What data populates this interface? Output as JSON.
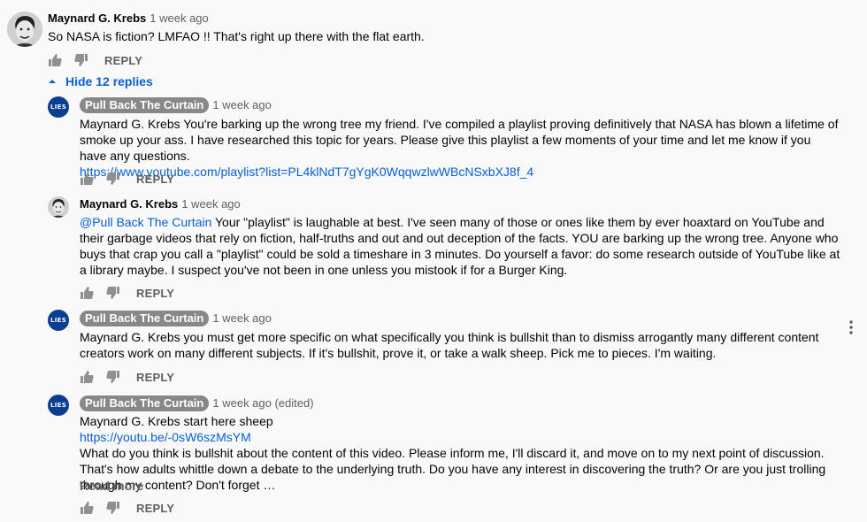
{
  "top_comment": {
    "author": "Maynard G. Krebs",
    "time": "1 week ago",
    "text": "So NASA is fiction?  LMFAO !!  That's right up there with the flat earth.",
    "reply_label": "REPLY"
  },
  "hide_replies_label": "Hide 12 replies",
  "avatar_text": "LIES",
  "replies": [
    {
      "author": "Pull Back The Curtain",
      "time": "1 week ago",
      "text": "Maynard G. Krebs You're barking up the wrong tree my friend. I've compiled a playlist proving definitively that NASA has blown a lifetime of smoke up your ass. I have researched this topic for years. Please give this playlist a few moments of your time and let me know if you have any questions.",
      "link": "https://www.youtube.com/playlist?list=PL4klNdT7gYgK0WqqwzlwWBcNSxbXJ8f_4",
      "reply_label": "REPLY"
    },
    {
      "author": "Maynard G. Krebs",
      "time": "1 week ago",
      "mention": "@Pull Back The Curtain",
      "text": " Your \"playlist\" is laughable at best. I've seen many of those or ones like them by ever hoaxtard on YouTube and their garbage videos that rely on fiction, half-truths and out and out deception of the facts.  YOU are barking up the wrong tree.  Anyone who buys that crap you call a \"playlist\" could be sold a timeshare in 3 minutes.  Do yourself a favor: do some research outside of YouTube like at a library maybe. I suspect you've not been in one unless you mistook if for a Burger King.",
      "reply_label": "REPLY"
    },
    {
      "author": "Pull Back The Curtain",
      "time": "1 week ago",
      "text": "Maynard G. Krebs you must get more specific on what specifically you think is bullshit than to dismiss arrogantly many different content  creators work on many different subjects. If it's bullshit, prove it, or take a walk sheep. Pick me to pieces. I'm waiting.",
      "reply_label": "REPLY"
    },
    {
      "author": "Pull Back The Curtain",
      "time": "1 week ago (edited)",
      "line1": "Maynard G. Krebs  start here sheep",
      "link": "https://youtu.be/-0sW6szMsYM",
      "text": "What do you think is bullshit about the content of this video. Please inform me, I'll discard it, and move on to my next point of discussion. That's how adults whittle down a debate to the underlying truth. Do you have any interest in discovering the truth? Or are you just trolling through my content? Don't forget …",
      "read_more": "Read more",
      "reply_label": "REPLY"
    }
  ]
}
